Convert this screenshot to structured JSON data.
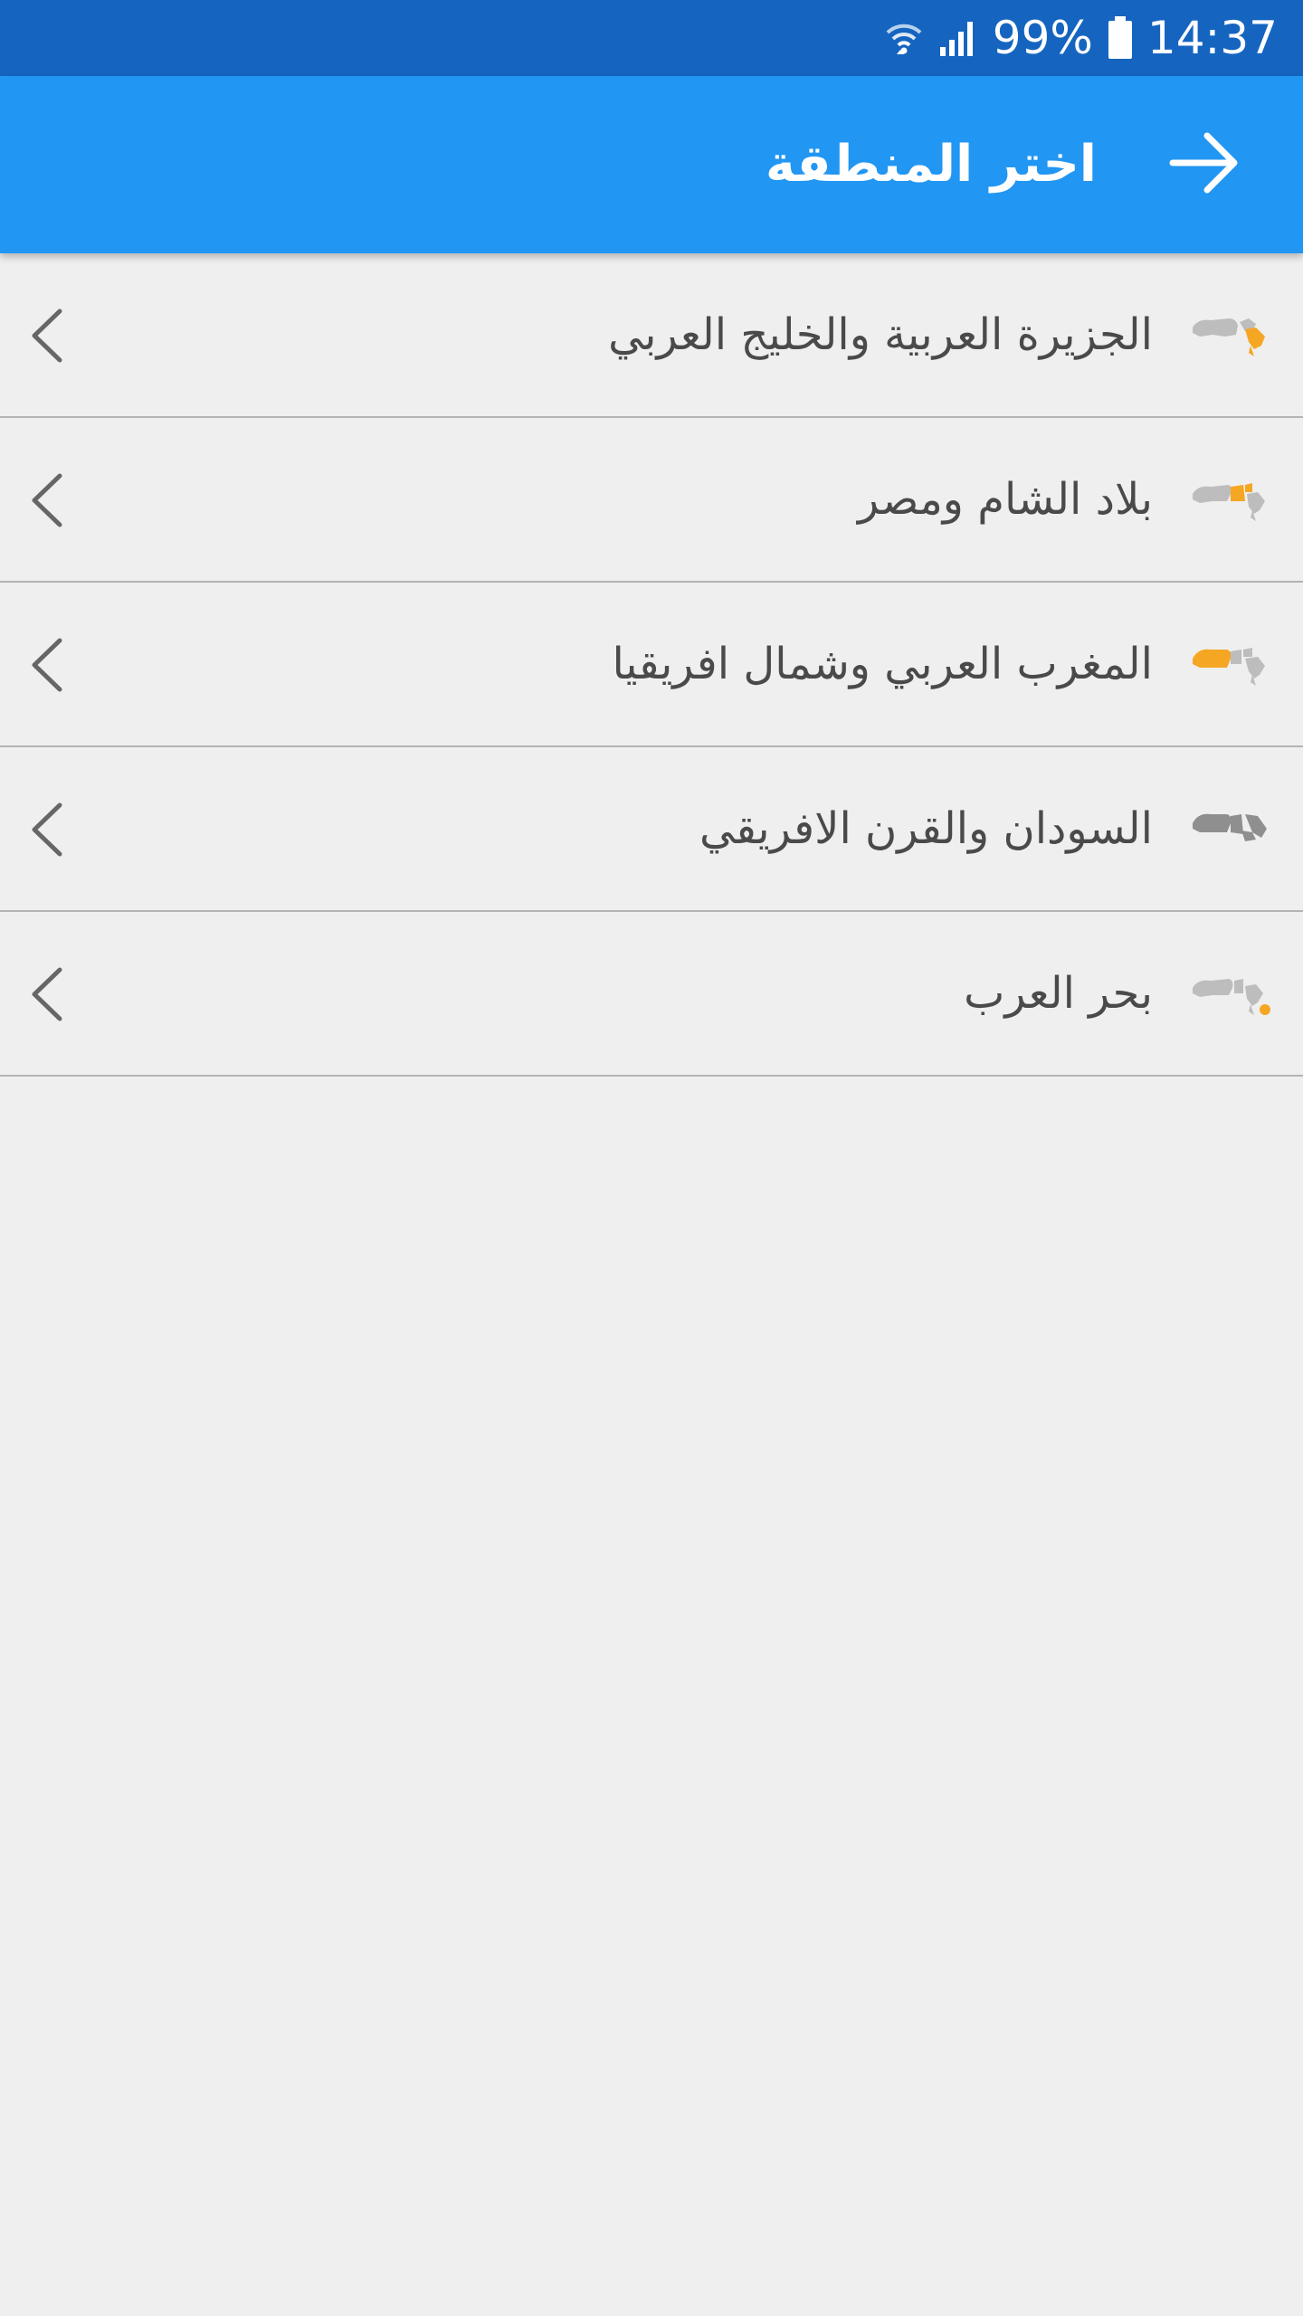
{
  "status_bar": {
    "battery_percent": "99%",
    "time": "14:37",
    "icons": [
      "wifi-icon",
      "signal-icon",
      "battery-icon"
    ]
  },
  "app_bar": {
    "title": "اختر المنطقة",
    "back_icon": "arrow-right-icon",
    "background": "#2196f3"
  },
  "regions": [
    {
      "label": "الجزيرة العربية والخليج العربي",
      "map_icon": "arabian-peninsula-map-icon"
    },
    {
      "label": "بلاد الشام ومصر",
      "map_icon": "levant-egypt-map-icon"
    },
    {
      "label": "المغرب العربي وشمال افريقيا",
      "map_icon": "maghreb-map-icon"
    },
    {
      "label": "السودان والقرن الافريقي",
      "map_icon": "sudan-horn-map-icon"
    },
    {
      "label": "بحر العرب",
      "map_icon": "arabian-sea-map-icon"
    }
  ],
  "colors": {
    "status_bar": "#1565c0",
    "app_bar": "#2196f3",
    "highlight": "#f5a623",
    "map_gray": "#bdbdbd",
    "background": "#efefef"
  }
}
